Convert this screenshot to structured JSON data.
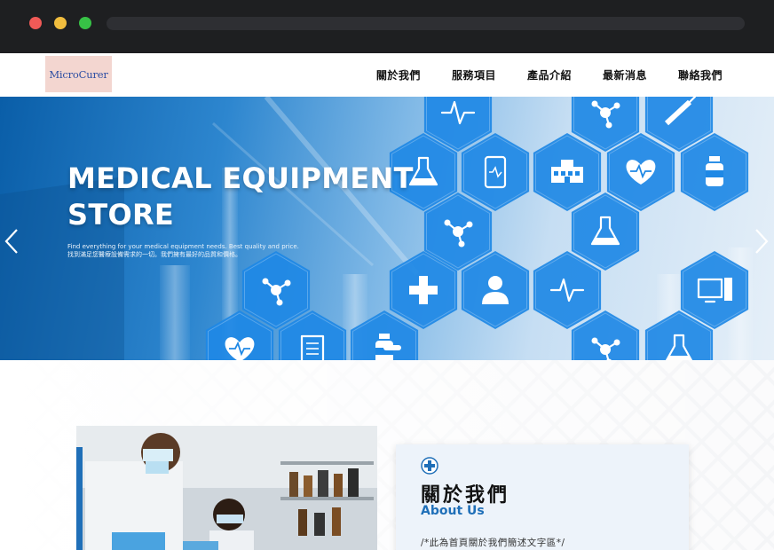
{
  "window": {
    "controls": [
      "close",
      "minimize",
      "maximize"
    ]
  },
  "header": {
    "logo_text": "MicroCurer",
    "nav": [
      {
        "label": "關於我們"
      },
      {
        "label": "服務項目"
      },
      {
        "label": "產品介紹"
      },
      {
        "label": "最新消息"
      },
      {
        "label": "聯絡我們"
      }
    ]
  },
  "hero": {
    "title_line1": "MEDICAL EQUIPMENT",
    "title_line2": "STORE",
    "subtitle_en": "Find everything for your medical equipment needs. Best quality and price.",
    "subtitle_zh": "找到滿足您醫療設備需求的一切。我們擁有最好的品質和價格。",
    "prev_icon": "chevron-left-icon",
    "next_icon": "chevron-right-icon"
  },
  "about": {
    "title": "關於我們",
    "subtitle": "About Us",
    "body": "/*此為首頁關於我們簡述文字區*/"
  },
  "colors": {
    "accent": "#1f6fb8",
    "hexagon": "#1e88e5",
    "chrome_bg": "#1e1f21",
    "logo_bg": "#f3d6d0"
  }
}
